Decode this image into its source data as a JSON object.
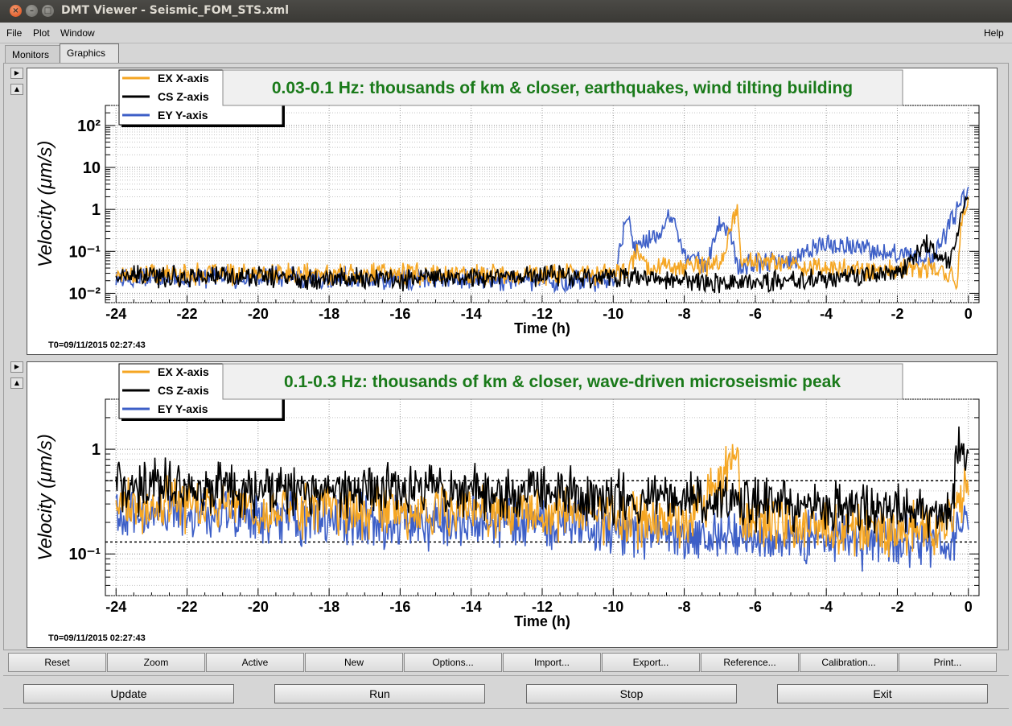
{
  "window": {
    "title": "DMT Viewer - Seismic_FOM_STS.xml"
  },
  "menu": {
    "file": "File",
    "plot": "Plot",
    "window": "Window",
    "help": "Help"
  },
  "tabs": [
    "Monitors",
    "Graphics"
  ],
  "active_tab": "Graphics",
  "colors": {
    "ex": "#f5a623",
    "cs": "#000000",
    "ey": "#3d5fc7",
    "title_text": "#1a7a1a"
  },
  "chart_data": [
    {
      "type": "line",
      "title": "0.03-0.1 Hz: thousands of km & closer, earthquakes, wind tilting building",
      "xlabel": "Time (h)",
      "ylabel": "Velocity  (μm/s)",
      "xlim": [
        -24.3,
        0.3
      ],
      "ylim": [
        0.006,
        300
      ],
      "yscale": "log",
      "x_ticks": [
        "-24",
        "-22",
        "-20",
        "-18",
        "-16",
        "-14",
        "-12",
        "-10",
        "-8",
        "-6",
        "-4",
        "-2",
        "0"
      ],
      "y_ticks": [
        "10⁻²",
        "10⁻¹",
        "1",
        "10",
        "10²"
      ],
      "grid": true,
      "legend_position": "top-left",
      "t0": "T0=09/11/2015 02:27:43",
      "series": [
        {
          "name": "EX X-axis",
          "color": "#f5a623",
          "points": [
            [
              -24,
              0.03
            ],
            [
              -20,
              0.028
            ],
            [
              -16,
              0.03
            ],
            [
              -12,
              0.028
            ],
            [
              -10,
              0.03
            ],
            [
              -9.6,
              0.03
            ],
            [
              -9.3,
              0.1
            ],
            [
              -9,
              0.04
            ],
            [
              -8.5,
              0.05
            ],
            [
              -8,
              0.04
            ],
            [
              -7,
              0.05
            ],
            [
              -6.5,
              1.0
            ],
            [
              -6.4,
              0.06
            ],
            [
              -5,
              0.05
            ],
            [
              -4,
              0.04
            ],
            [
              -2,
              0.035
            ],
            [
              -1,
              0.04
            ],
            [
              -0.3,
              0.02
            ],
            [
              -0.2,
              0.5
            ],
            [
              0,
              1.5
            ]
          ]
        },
        {
          "name": "CS Z-axis",
          "color": "#000000",
          "points": [
            [
              -24,
              0.025
            ],
            [
              -20,
              0.025
            ],
            [
              -16,
              0.022
            ],
            [
              -12,
              0.028
            ],
            [
              -10,
              0.025
            ],
            [
              -8,
              0.02
            ],
            [
              -6,
              0.018
            ],
            [
              -4,
              0.022
            ],
            [
              -2,
              0.03
            ],
            [
              -1.2,
              0.15
            ],
            [
              -0.5,
              0.05
            ],
            [
              -0.2,
              0.8
            ],
            [
              0,
              1.8
            ]
          ]
        },
        {
          "name": "EY Y-axis",
          "color": "#3d5fc7",
          "points": [
            [
              -24,
              0.022
            ],
            [
              -20,
              0.025
            ],
            [
              -16,
              0.022
            ],
            [
              -12,
              0.02
            ],
            [
              -10,
              0.02
            ],
            [
              -9.9,
              0.05
            ],
            [
              -9.6,
              1.0
            ],
            [
              -9.4,
              0.1
            ],
            [
              -8.7,
              0.3
            ],
            [
              -8.3,
              1.0
            ],
            [
              -8,
              0.08
            ],
            [
              -7.4,
              0.05
            ],
            [
              -7,
              0.5
            ],
            [
              -6.7,
              0.3
            ],
            [
              -6.5,
              0.05
            ],
            [
              -6,
              0.05
            ],
            [
              -5,
              0.06
            ],
            [
              -4,
              0.15
            ],
            [
              -3,
              0.12
            ],
            [
              -2,
              0.08
            ],
            [
              -1,
              0.07
            ],
            [
              -0.2,
              1.5
            ],
            [
              0,
              2.0
            ]
          ]
        }
      ]
    },
    {
      "type": "line",
      "title": "0.1-0.3 Hz: thousands of km & closer, wave-driven microseismic peak",
      "xlabel": "Time (h)",
      "ylabel": "Velocity  (μm/s)",
      "xlim": [
        -24.3,
        0.3
      ],
      "ylim": [
        0.04,
        3
      ],
      "yscale": "log",
      "x_ticks": [
        "-24",
        "-22",
        "-20",
        "-18",
        "-16",
        "-14",
        "-12",
        "-10",
        "-8",
        "-6",
        "-4",
        "-2",
        "0"
      ],
      "y_ticks": [
        "10⁻¹",
        "1"
      ],
      "grid": true,
      "legend_position": "top-left",
      "reference_lines": [
        0.5,
        0.13
      ],
      "t0": "T0=09/11/2015 02:27:43",
      "series": [
        {
          "name": "EX X-axis",
          "color": "#f5a623",
          "points": [
            [
              -24,
              0.3
            ],
            [
              -20,
              0.27
            ],
            [
              -16,
              0.25
            ],
            [
              -12,
              0.25
            ],
            [
              -10,
              0.22
            ],
            [
              -8,
              0.2
            ],
            [
              -6.5,
              0.8
            ],
            [
              -6.4,
              0.2
            ],
            [
              -4,
              0.18
            ],
            [
              -2,
              0.17
            ],
            [
              -0.5,
              0.18
            ],
            [
              0,
              0.5
            ]
          ]
        },
        {
          "name": "CS Z-axis",
          "color": "#000000",
          "points": [
            [
              -24,
              0.45
            ],
            [
              -20,
              0.42
            ],
            [
              -16,
              0.4
            ],
            [
              -12,
              0.38
            ],
            [
              -10,
              0.35
            ],
            [
              -8,
              0.33
            ],
            [
              -6,
              0.3
            ],
            [
              -4,
              0.28
            ],
            [
              -2,
              0.27
            ],
            [
              -0.5,
              0.25
            ],
            [
              -0.3,
              1.0
            ],
            [
              0,
              0.7
            ]
          ]
        },
        {
          "name": "EY Y-axis",
          "color": "#3d5fc7",
          "points": [
            [
              -24,
              0.25
            ],
            [
              -20,
              0.22
            ],
            [
              -16,
              0.2
            ],
            [
              -12,
              0.2
            ],
            [
              -10,
              0.17
            ],
            [
              -8,
              0.15
            ],
            [
              -6,
              0.14
            ],
            [
              -4,
              0.14
            ],
            [
              -2,
              0.13
            ],
            [
              -0.5,
              0.13
            ],
            [
              0,
              0.3
            ]
          ]
        }
      ]
    }
  ],
  "toolbar": [
    "Reset",
    "Zoom",
    "Active",
    "New",
    "Options...",
    "Import...",
    "Export...",
    "Reference...",
    "Calibration...",
    "Print..."
  ],
  "actions": [
    "Update",
    "Run",
    "Stop",
    "Exit"
  ]
}
